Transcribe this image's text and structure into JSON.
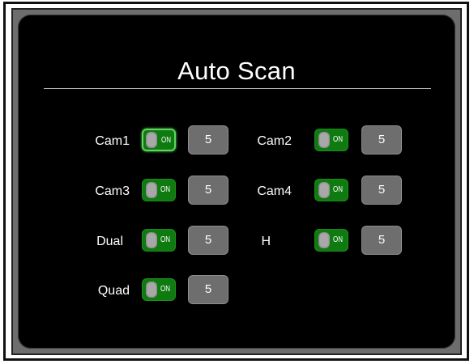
{
  "screen": {
    "title": "Auto Scan"
  },
  "colors": {
    "panel_bg": "#000000",
    "toggle_on": "#0f7a10",
    "value_box": "#6e6e6e",
    "text": "#ffffff"
  },
  "rows": [
    {
      "label": "Cam1",
      "toggle_text": "ON",
      "value": "5",
      "state": "on"
    },
    {
      "label": "Cam2",
      "toggle_text": "ON",
      "value": "5",
      "state": "on"
    },
    {
      "label": "Cam3",
      "toggle_text": "ON",
      "value": "5",
      "state": "on"
    },
    {
      "label": "Cam4",
      "toggle_text": "ON",
      "value": "5",
      "state": "on"
    },
    {
      "label": "Dual",
      "toggle_text": "ON",
      "value": "5",
      "state": "on"
    },
    {
      "label": "H",
      "toggle_text": "ON",
      "value": "5",
      "state": "on"
    },
    {
      "label": "Quad",
      "toggle_text": "ON",
      "value": "5",
      "state": "on"
    }
  ]
}
